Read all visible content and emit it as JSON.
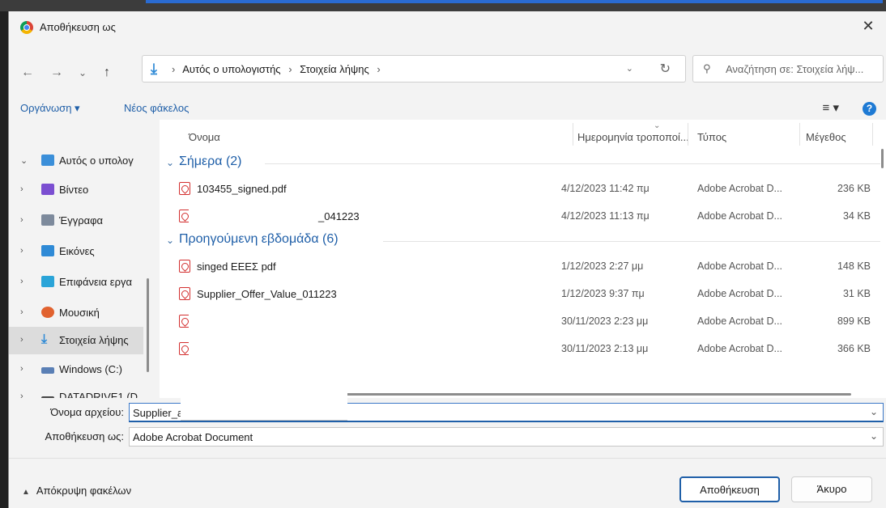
{
  "window": {
    "title": "Αποθήκευση ως",
    "close_glyph": "✕"
  },
  "nav": {
    "back_glyph": "←",
    "forward_glyph": "→",
    "recent_glyph": "⌄",
    "up_glyph": "↑",
    "breadcrumb": [
      "Αυτός ο υπολογιστής",
      "Στοιχεία λήψης"
    ],
    "sep": "›",
    "dropdown_glyph": "⌄",
    "refresh_glyph": "↻",
    "search_placeholder": "Αναζήτηση σε: Στοιχεία λήψ..."
  },
  "toolbar": {
    "organize": "Οργάνωση ▾",
    "new_folder": "Νέος φάκελος",
    "view_glyph": "≡ ▾",
    "help_glyph": "?"
  },
  "sidebar": {
    "items": [
      {
        "label": "Αυτός ο υπολογ",
        "icon": "computer-icon",
        "color": "#3b8fd9",
        "chevron": "⌄"
      },
      {
        "label": "Βίντεο",
        "icon": "video-icon",
        "color": "#7b4fd1",
        "chevron": "›"
      },
      {
        "label": "Έγγραφα",
        "icon": "documents-icon",
        "color": "#7d8a9c",
        "chevron": "›"
      },
      {
        "label": "Εικόνες",
        "icon": "pictures-icon",
        "color": "#2f8ad6",
        "chevron": "›"
      },
      {
        "label": "Επιφάνεια εργα",
        "icon": "desktop-icon",
        "color": "#2aa4d8",
        "chevron": "›"
      },
      {
        "label": "Μουσική",
        "icon": "music-icon",
        "color": "#e1622f",
        "chevron": "›"
      },
      {
        "label": "Στοιχεία λήψης",
        "icon": "downloads-icon",
        "color": "#2f8ad6",
        "chevron": "›"
      },
      {
        "label": "Windows (C:)",
        "icon": "drive-icon",
        "color": "#5a7fb5",
        "chevron": "›"
      },
      {
        "label": "DATADRIVE1 (D",
        "icon": "drive-icon",
        "color": "#444444",
        "chevron": "›"
      }
    ]
  },
  "columns": {
    "name": "Όνομα",
    "date": "Ημερομηνία τροποποί...",
    "type": "Τύπος",
    "size": "Μέγεθος"
  },
  "groups": [
    {
      "label": "Σήμερα (2)"
    },
    {
      "label": "Προηγούμενη εβδομάδα (6)"
    }
  ],
  "files": [
    {
      "name": "103455_signed.pdf",
      "date": "4/12/2023 11:42 πμ",
      "type": "Adobe Acrobat D...",
      "size": "236 KB"
    },
    {
      "name": "_041223",
      "date": "4/12/2023 11:13 πμ",
      "type": "Adobe Acrobat D...",
      "size": "34 KB"
    },
    {
      "name": "singed ΕΕΕΣ pdf",
      "date": "1/12/2023 2:27 μμ",
      "type": "Adobe Acrobat D...",
      "size": "148 KB"
    },
    {
      "name": "Supplier_Offer_Value_011223",
      "date": "1/12/2023 9:37 πμ",
      "type": "Adobe Acrobat D...",
      "size": "31 KB"
    },
    {
      "name": "",
      "date": "30/11/2023 2:23 μμ",
      "type": "Adobe Acrobat D...",
      "size": "899 KB"
    },
    {
      "name": "",
      "date": "30/11/2023 2:13 μμ",
      "type": "Adobe Acrobat D...",
      "size": "366 KB"
    }
  ],
  "fields": {
    "filename_label": "Όνομα αρχείου:",
    "filename_value": "Supplier_ap",
    "savetype_label": "Αποθήκευση ως:",
    "savetype_value": "Adobe Acrobat Document",
    "dropdown_glyph": "⌄"
  },
  "footer": {
    "hide_folders": "Απόκρυψη φακέλων",
    "save": "Αποθήκευση",
    "cancel": "Άκυρο"
  }
}
